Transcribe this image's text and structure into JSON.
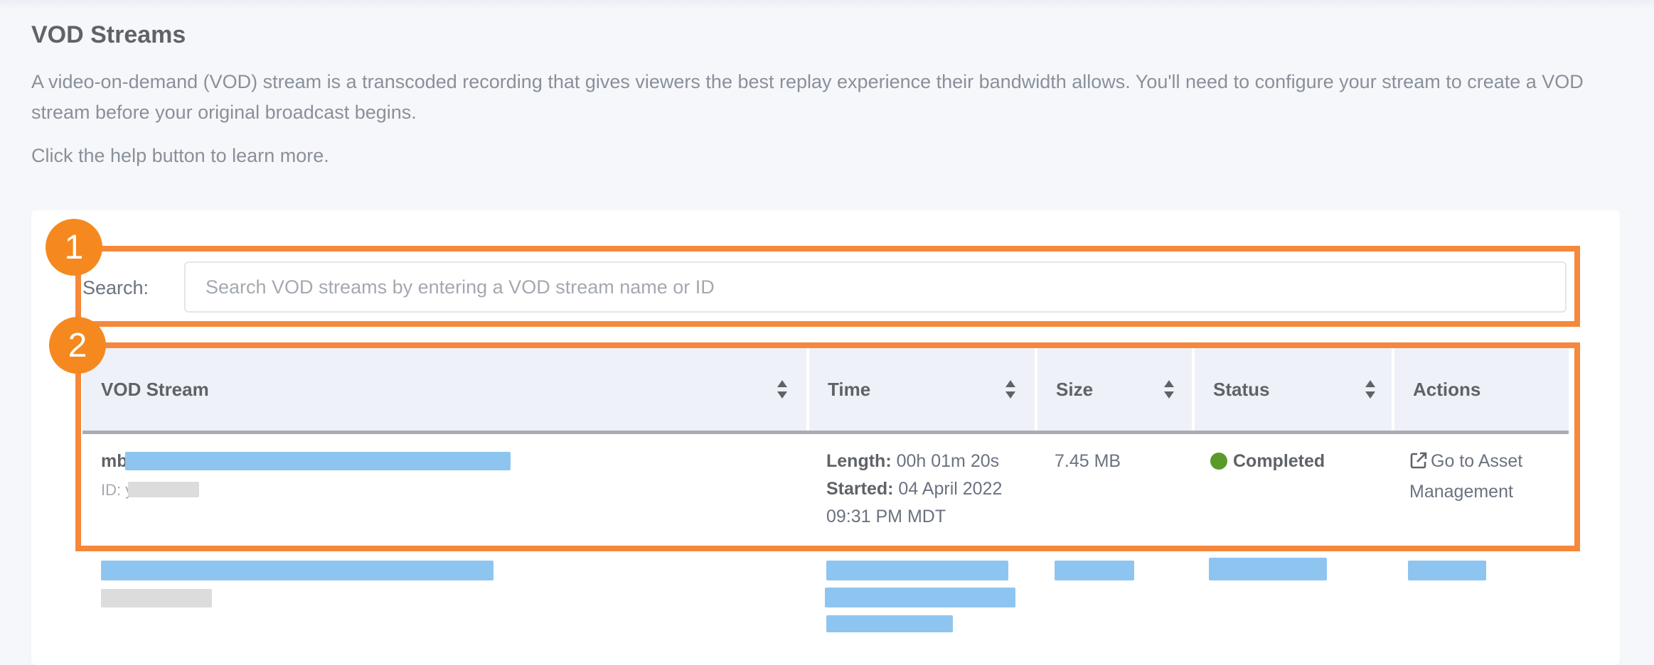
{
  "page": {
    "title": "VOD Streams",
    "description": "A video-on-demand (VOD) stream is a transcoded recording that gives viewers the best replay experience their bandwidth allows. You'll need to configure your stream to create a VOD stream before your original broadcast begins.",
    "help_text": "Click the help button to learn more."
  },
  "search": {
    "label": "Search:",
    "placeholder": "Search VOD streams by entering a VOD stream name or ID"
  },
  "table": {
    "columns": [
      {
        "label": "VOD Stream",
        "sortable": true
      },
      {
        "label": "Time",
        "sortable": true
      },
      {
        "label": "Size",
        "sortable": true
      },
      {
        "label": "Status",
        "sortable": true
      },
      {
        "label": "Actions",
        "sortable": false
      }
    ],
    "rows": [
      {
        "name_prefix": "mb",
        "id_prefix": "ID: y",
        "length_label": "Length:",
        "length_value": "00h 01m 20s",
        "started_label": "Started:",
        "started_value": "04 April 2022",
        "started_time": "09:31 PM MDT",
        "size": "7.45 MB",
        "status": "Completed",
        "status_color": "#5a9a2a",
        "action_line1": "Go to Asset",
        "action_line2": "Management",
        "action_icon": "external-link-icon"
      }
    ]
  },
  "callouts": [
    "1",
    "2"
  ],
  "colors": {
    "callout": "#f5883a",
    "redaction": "#8ec5f0",
    "header_bg": "#eef1f7"
  }
}
